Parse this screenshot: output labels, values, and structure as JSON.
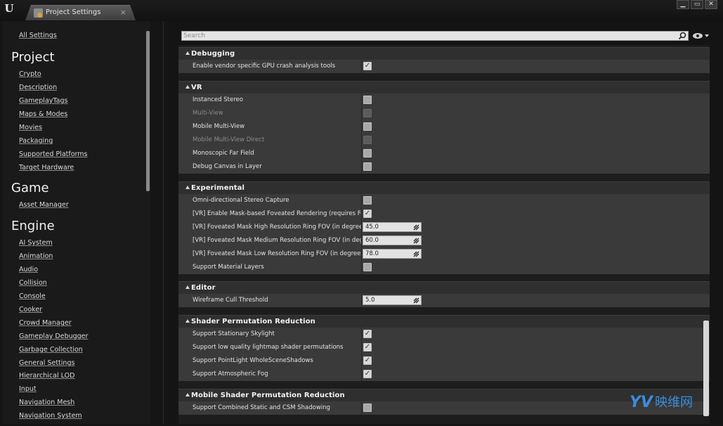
{
  "window": {
    "tab_title": "Project Settings",
    "tab_close": "×",
    "controls": [
      "▁",
      "▭",
      "✕"
    ],
    "logo": "U"
  },
  "sidebar": {
    "all_settings": "All Settings",
    "groups": [
      {
        "heading": "Project",
        "items": [
          "Crypto",
          "Description",
          "GameplayTags",
          "Maps & Modes",
          "Movies",
          "Packaging",
          "Supported Platforms",
          "Target Hardware"
        ]
      },
      {
        "heading": "Game",
        "items": [
          "Asset Manager"
        ]
      },
      {
        "heading": "Engine",
        "items": [
          "AI System",
          "Animation",
          "Audio",
          "Collision",
          "Console",
          "Cooker",
          "Crowd Manager",
          "Gameplay Debugger",
          "Garbage Collection",
          "General Settings",
          "Hierarchical LOD",
          "Input",
          "Navigation Mesh",
          "Navigation System"
        ]
      }
    ]
  },
  "search": {
    "placeholder": "Search"
  },
  "sections": [
    {
      "title": "Debugging",
      "rows": [
        {
          "name": "Enable vendor specific GPU crash analysis tools",
          "type": "checkbox",
          "checked": true
        }
      ]
    },
    {
      "title": "VR",
      "rows": [
        {
          "name": "Instanced Stereo",
          "type": "checkbox",
          "checked": false
        },
        {
          "name": "Multi-View",
          "type": "checkbox",
          "checked": false,
          "disabled": true
        },
        {
          "name": "Mobile Multi-View",
          "type": "checkbox",
          "checked": false
        },
        {
          "name": "Mobile Multi-View Direct",
          "type": "checkbox",
          "checked": false,
          "disabled": true
        },
        {
          "name": "Monoscopic Far Field",
          "type": "checkbox",
          "checked": false
        },
        {
          "name": "Debug Canvas in Layer",
          "type": "checkbox",
          "checked": false
        }
      ]
    },
    {
      "title": "Experimental",
      "rows": [
        {
          "name": "Omni-directional Stereo Capture",
          "type": "checkbox",
          "checked": false
        },
        {
          "name": "[VR] Enable Mask-based Foveated Rendering (requires Forwa",
          "type": "checkbox",
          "checked": true
        },
        {
          "name": "[VR] Foveated Mask High Resolution Ring FOV (in degrees)",
          "type": "number",
          "value": "45.0"
        },
        {
          "name": "[VR] Foveated Mask Medium Resolution Ring FOV (in degrees",
          "type": "number",
          "value": "60.0"
        },
        {
          "name": "[VR] Foveated Mask Low Resolution Ring FOV (in degrees)",
          "type": "number",
          "value": "78.0"
        },
        {
          "name": "Support Material Layers",
          "type": "checkbox",
          "checked": false
        }
      ]
    },
    {
      "title": "Editor",
      "rows": [
        {
          "name": "Wireframe Cull Threshold",
          "type": "number",
          "value": "5.0"
        }
      ]
    },
    {
      "title": "Shader Permutation Reduction",
      "rows": [
        {
          "name": "Support Stationary Skylight",
          "type": "checkbox",
          "checked": true
        },
        {
          "name": "Support low quality lightmap shader permutations",
          "type": "checkbox",
          "checked": true
        },
        {
          "name": "Support PointLight WholeSceneShadows",
          "type": "checkbox",
          "checked": true
        },
        {
          "name": "Support Atmospheric Fog",
          "type": "checkbox",
          "checked": true
        }
      ]
    },
    {
      "title": "Mobile Shader Permutation Reduction",
      "rows": [
        {
          "name": "Support Combined Static and CSM Shadowing",
          "type": "checkbox",
          "checked": false
        }
      ]
    }
  ],
  "watermark": {
    "logo": "YV",
    "text": "映维网"
  },
  "colors": {
    "accent": "#3b8de0",
    "panel": "#3a3a3a",
    "header": "#2f2f2f"
  }
}
